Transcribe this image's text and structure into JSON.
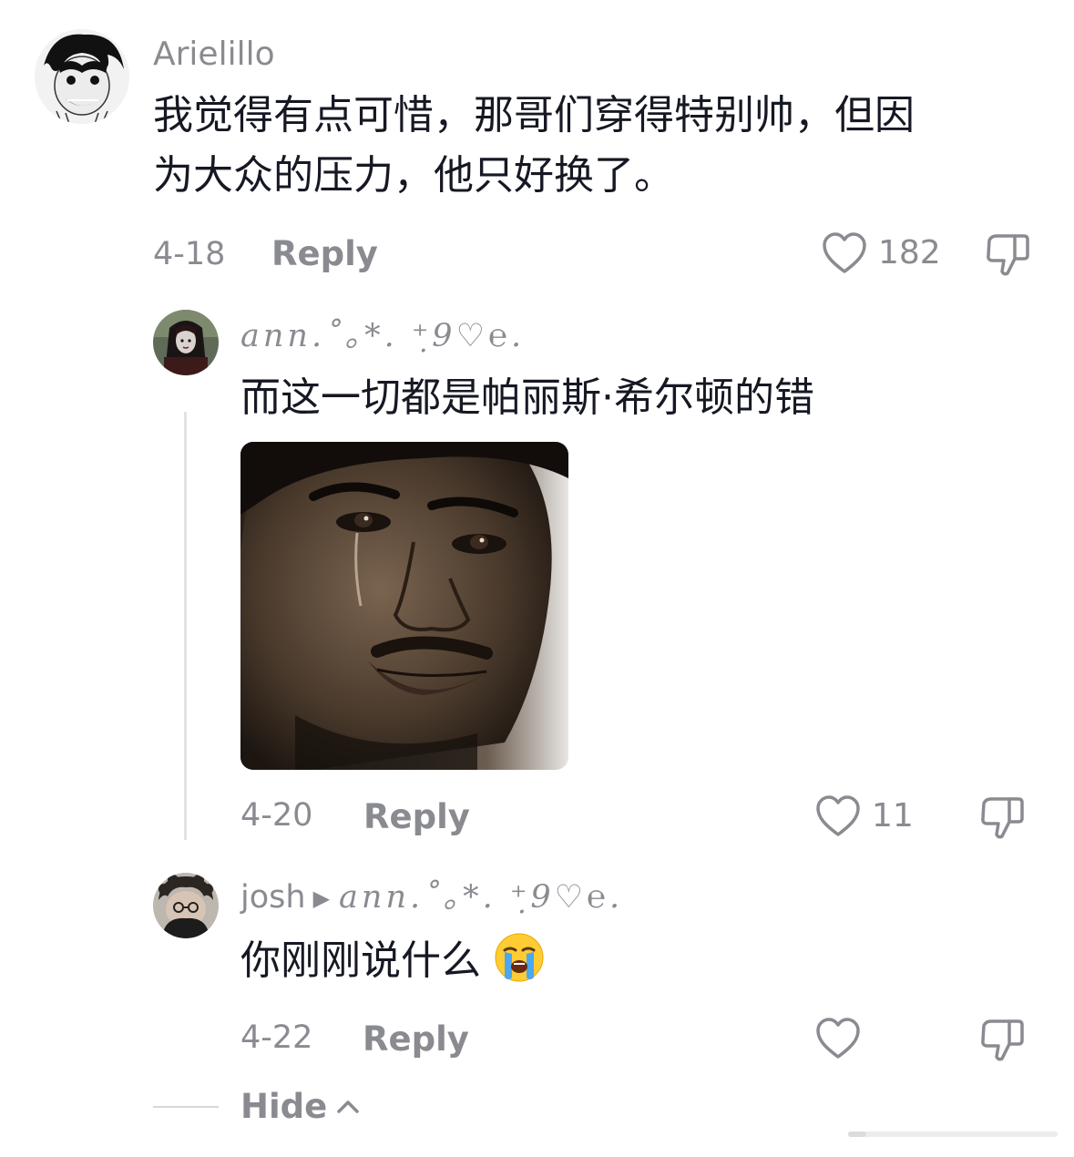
{
  "comments": [
    {
      "username": "Arielillo",
      "text_lines": [
        "我觉得有点可惜，那哥们穿得特别帅，但因",
        "为大众的压力，他只好换了。"
      ],
      "date": "4-18",
      "reply_label": "Reply",
      "like_count": "182",
      "avatar_icon": "manga-avatar"
    },
    {
      "username": "𝑎𝑛𝑛.˚｡*. ⁺̣9♡℮.",
      "text_lines": [
        "而这一切都是帕丽斯·希尔顿的错"
      ],
      "date": "4-20",
      "reply_label": "Reply",
      "like_count": "11",
      "avatar_icon": "goth-avatar",
      "image_icon": "crying-man-photo"
    },
    {
      "username": "josh",
      "reply_to": "𝑎𝑛𝑛.˚｡*. ⁺̣9♡℮.",
      "text_lines": [
        "你刚刚说什么"
      ],
      "emoji": "loudly-crying-face",
      "date": "4-22",
      "reply_label": "Reply",
      "like_count": "",
      "avatar_icon": "curly-hair-avatar"
    }
  ],
  "hide_label": "Hide",
  "colors": {
    "text_primary": "#161823",
    "text_secondary": "#8a8b91",
    "thread_line": "#e3e3e4"
  }
}
